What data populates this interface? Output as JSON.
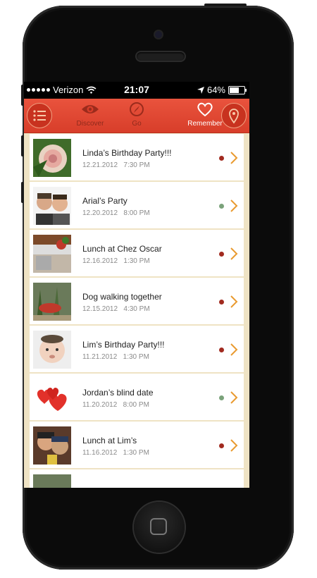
{
  "status_bar": {
    "carrier": "Verizon",
    "time": "21:07",
    "battery": "64%",
    "battery_level": 0.64
  },
  "nav": {
    "tabs": [
      {
        "label": "Discover",
        "icon": "eye-icon"
      },
      {
        "label": "Go",
        "icon": "compass-icon"
      },
      {
        "label": "Remember",
        "icon": "heart-icon",
        "active": true
      }
    ],
    "menu_icon": "list-menu-icon",
    "location_icon": "map-pin-icon"
  },
  "colors": {
    "accent": "#d83e2a",
    "background": "#efe3c4",
    "dot_red": "#a12a1f",
    "dot_green": "#7aa27a",
    "chevron": "#e99a2f"
  },
  "events": [
    {
      "title": "Linda’s Birthday Party!!!",
      "date": "12.21.2012",
      "time": "7:30 PM",
      "status": "red",
      "thumb": "rose"
    },
    {
      "title": "Arial’s Party",
      "date": "12.20.2012",
      "time": "8:00 PM",
      "status": "green",
      "thumb": "two-men"
    },
    {
      "title": "Lunch at Chez Oscar",
      "date": "12.16.2012",
      "time": "1:30 PM",
      "status": "red",
      "thumb": "kitchen"
    },
    {
      "title": "Dog walking together",
      "date": "12.15.2012",
      "time": "4:30 PM",
      "status": "red",
      "thumb": "garden"
    },
    {
      "title": "Lim’s Birthday Party!!!",
      "date": "11.21.2012",
      "time": "1:30 PM",
      "status": "red",
      "thumb": "baby"
    },
    {
      "title": "Jordan’s blind date",
      "date": "11.20.2012",
      "time": "8:00 PM",
      "status": "green",
      "thumb": "hearts"
    },
    {
      "title": "Lunch at Lim’s",
      "date": "11.16.2012",
      "time": "1:30 PM",
      "status": "red",
      "thumb": "selfie"
    }
  ]
}
